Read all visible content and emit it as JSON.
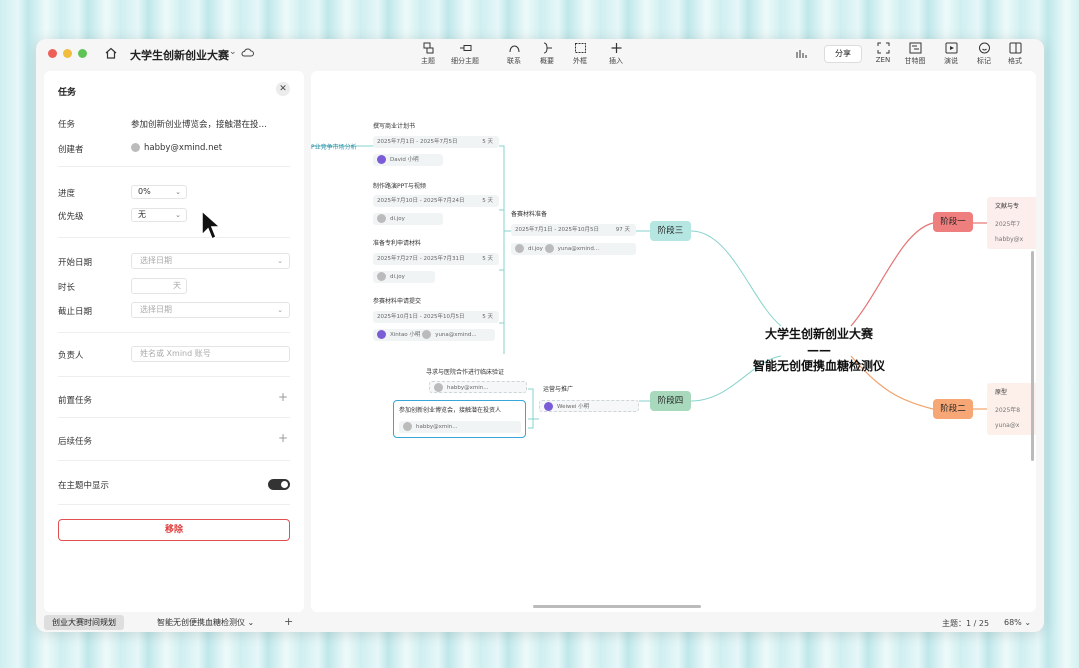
{
  "window": {
    "title": "大学生创新创业大赛"
  },
  "toolbar": {
    "topic": "主题",
    "subtopic": "细分主题",
    "relation": "联系",
    "summary": "概要",
    "boundary": "外框",
    "insert": "插入",
    "share": "分享",
    "zen": "ZEN",
    "gantt": "甘特图",
    "present": "演说",
    "marker": "标记",
    "format": "格式"
  },
  "panel": {
    "title": "任务",
    "task_label": "任务",
    "task_value": "参加创新创业博览会，接触潜在投…",
    "creator_label": "创建者",
    "creator_value": "habby@xmind.net",
    "progress_label": "进度",
    "progress_value": "0%",
    "priority_label": "优先级",
    "priority_value": "无",
    "start_label": "开始日期",
    "start_placeholder": "选择日期",
    "duration_label": "时长",
    "duration_unit": "天",
    "end_label": "截止日期",
    "end_placeholder": "选择日期",
    "assignee_label": "负责人",
    "assignee_placeholder": "姓名或 Xmind 账号",
    "prev_task_label": "前置任务",
    "next_task_label": "后续任务",
    "show_in_topic_label": "在主题中显示",
    "remove_label": "移除"
  },
  "canvas": {
    "center_line1": "大学生创新创业大赛",
    "center_line2": "——",
    "center_line3": "智能无创便携血糖检测仪",
    "stage1": "阶段一",
    "stage2": "阶段二",
    "stage3": "阶段三",
    "stage4": "阶段四",
    "left_cut": "P业竞争市场分析",
    "t1": "撰写商业计划书",
    "t1_date": "2025年7月1日 - 2025年7月5日",
    "t1_days": "5 天",
    "t1_user": "David 小明",
    "t2": "制作路演PPT与视频",
    "t2_date": "2025年7月10日 - 2025年7月24日",
    "t2_days": "5 天",
    "t2_user": "di.joy",
    "t3": "准备专利申请材料",
    "t3_date": "2025年7月27日 - 2025年7月31日",
    "t3_days": "5 天",
    "t3_user": "di.joy",
    "t4": "参赛材料申请提交",
    "t4_date": "2025年10月1日 - 2025年10月5日",
    "t4_days": "5 天",
    "t4_user": "Xintao 小明",
    "t4_user2": "yuna@xmind...",
    "t5": "备赛材料准备",
    "t5_date": "2025年7月1日 - 2025年10月5日",
    "t5_days": "97 天",
    "t5_user": "di.joy",
    "t5_user2": "yuna@xmind...",
    "t6": "寻求与医院合作进行临床验证",
    "t6_user": "habby@xmin...",
    "t7": "参加创新创业博览会，接触潜在投资人",
    "t7_user": "habby@xmin...",
    "t8": "运营与推广",
    "t8_user": "Weiwei 小明",
    "r1": "文献与专",
    "r1_date": "2025年7",
    "r1_user": "habby@x",
    "r2": "原型",
    "r2_date": "2025年8",
    "r2_user": "yuna@x"
  },
  "bottom": {
    "sheet1": "创业大赛时间规划",
    "sheet2": "智能无创便携血糖检测仪",
    "topic_count": "主题：1 / 25",
    "zoom": "68%"
  },
  "colors": {
    "teal": "#7fd0cb",
    "red": "#e56a6a",
    "orange": "#f29a62",
    "green": "#8fc8a8",
    "accent_blue": "#3aa5d8"
  }
}
